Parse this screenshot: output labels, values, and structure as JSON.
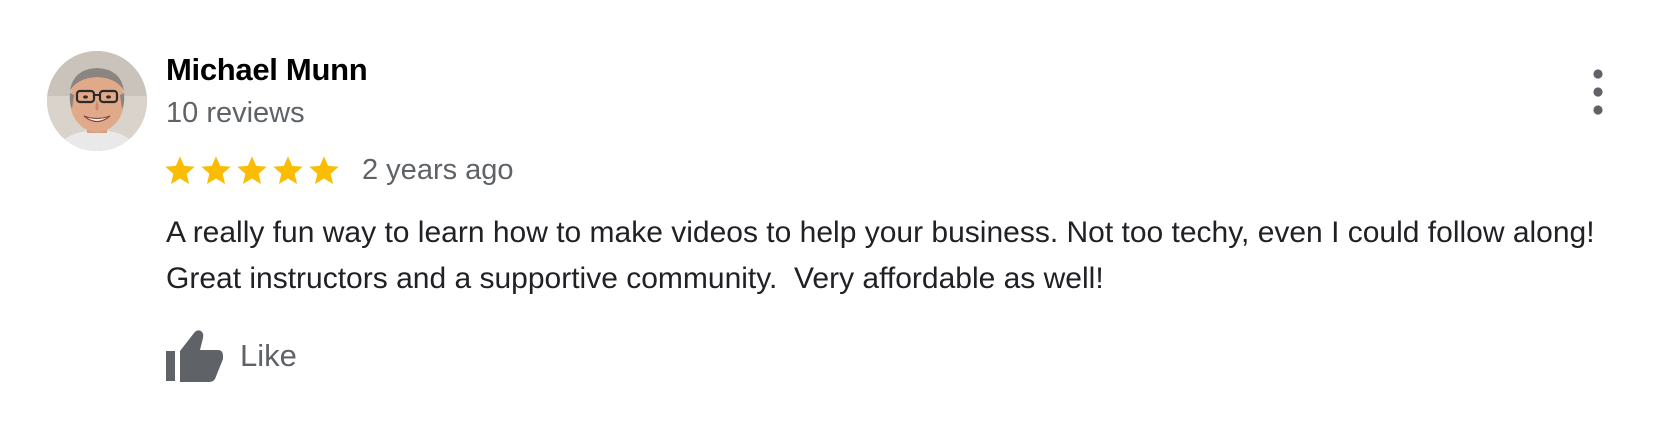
{
  "review": {
    "author_name": "Michael Munn",
    "review_count": "10 reviews",
    "rating": 5,
    "rating_max": 5,
    "date": "2 years ago",
    "text": "A really fun way to learn how to make videos to help your business. Not too techy, even I could follow along!  Great instructors and a supportive community.  Very affordable as well!",
    "like_label": "Like"
  },
  "icons": {
    "avatar": "avatar-photo",
    "star": "star-icon",
    "more": "more-vert-icon",
    "like": "thumb-up-icon"
  },
  "colors": {
    "star": "#FBBC04",
    "secondary_text": "#5f6368",
    "primary_text": "#202124",
    "icon": "#5f6368"
  }
}
